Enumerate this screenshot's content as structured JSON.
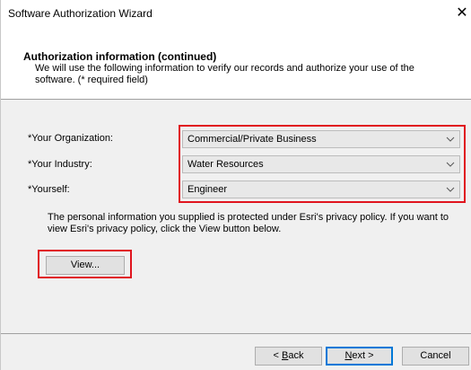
{
  "window": {
    "title": "Software Authorization Wizard",
    "close_glyph": "✕"
  },
  "header": {
    "title": "Authorization information (continued)",
    "description": "We will use the following information to verify our records and authorize your use of the software. (* required field)"
  },
  "form": {
    "organization": {
      "label": "*Your Organization:",
      "value": "Commercial/Private Business"
    },
    "industry": {
      "label": "*Your Industry:",
      "value": "Water Resources"
    },
    "yourself": {
      "label": "*Yourself:",
      "value": "Engineer"
    }
  },
  "privacy": {
    "text": "The personal information you supplied is protected under Esri's privacy policy. If you want to view Esri's privacy policy, click the View button below."
  },
  "buttons": {
    "view": "View...",
    "back_mnemonic": "B",
    "back_rest": "ack",
    "back_prefix": "< ",
    "next_mnemonic": "N",
    "next_rest": "ext >",
    "cancel": "Cancel"
  },
  "colors": {
    "highlight": "#e0141e",
    "focus": "#0078d7"
  }
}
